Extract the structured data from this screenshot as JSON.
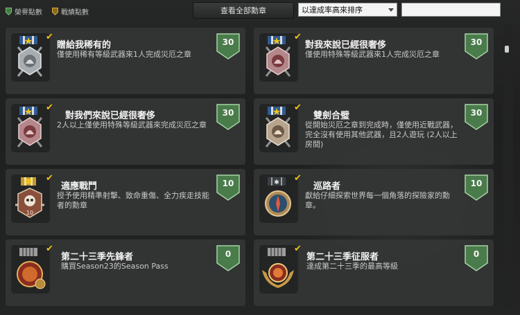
{
  "tabs": [
    {
      "label": "榮譽點數",
      "color": "#5aa35a"
    },
    {
      "label": "戰績點數",
      "color": "#c39a2a"
    }
  ],
  "toolbar": {
    "view_all_label": "查看全部勳章",
    "sort_value": "以達成率高來排序",
    "search_value": ""
  },
  "medals": [
    {
      "title": "贈給我稀有的",
      "desc": "僅使用稀有等級武器來1人完成災厄之章",
      "points": "30",
      "icon": "silver-star-medal-icon"
    },
    {
      "title": "對我來說已經很奢侈",
      "desc": "僅使用特殊等級武器來1人完成災厄之章",
      "points": "30",
      "icon": "red-star-medal-icon"
    },
    {
      "title": "對我們來說已經很奢侈",
      "desc": "2人以上僅使用特殊等級武器來完成災厄之章",
      "points": "30",
      "icon": "red-star-medal-icon"
    },
    {
      "title": "雙劍合璧",
      "desc": "從開始災厄之章到完成時，僅使用近戰武器，完全沒有使用其他武器，且2人遊玩 (2人以上房間)",
      "points": "30",
      "icon": "bronze-star-medal-icon"
    },
    {
      "title": "適應戰鬥",
      "desc": "授予使用精準射擊、致命重傷、全力疾走技能者的勳章",
      "points": "10",
      "icon": "skull-medal-icon"
    },
    {
      "title": "巡路者",
      "desc": "獻給仔細探索世界每一個角落的探險家的勳章。",
      "points": "10",
      "icon": "compass-medal-icon"
    },
    {
      "title": "第二十三季先鋒者",
      "desc": "購買Season23的Season Pass",
      "points": "0",
      "icon": "season-pioneer-medal-icon"
    },
    {
      "title": "第二十三季征服者",
      "desc": "達成第二十三季的最高等級",
      "points": "0",
      "icon": "season-conqueror-medal-icon"
    }
  ]
}
